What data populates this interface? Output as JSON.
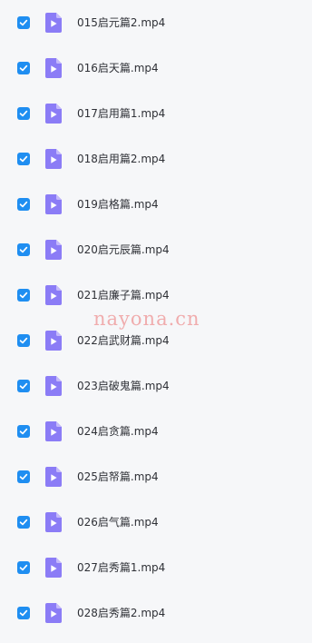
{
  "files": [
    {
      "name": "015启元篇2.mp4",
      "checked": true
    },
    {
      "name": "016启天篇.mp4",
      "checked": true
    },
    {
      "name": "017启用篇1.mp4",
      "checked": true
    },
    {
      "name": "018启用篇2.mp4",
      "checked": true
    },
    {
      "name": "019启格篇.mp4",
      "checked": true
    },
    {
      "name": "020启元辰篇.mp4",
      "checked": true
    },
    {
      "name": "021启廉子篇.mp4",
      "checked": true
    },
    {
      "name": "022启武财篇.mp4",
      "checked": true
    },
    {
      "name": "023启破鬼篇.mp4",
      "checked": true
    },
    {
      "name": "024启贪篇.mp4",
      "checked": true
    },
    {
      "name": "025启帑篇.mp4",
      "checked": true
    },
    {
      "name": "026启气篇.mp4",
      "checked": true
    },
    {
      "name": "027启秀篇1.mp4",
      "checked": true
    },
    {
      "name": "028启秀篇2.mp4",
      "checked": true
    }
  ],
  "watermark": "nayona.cn",
  "colors": {
    "checkbox": "#1f8ef1",
    "file_icon": "#8b7cf6",
    "file_icon_fold": "#c4b9fb",
    "background": "#f6f7f9",
    "text": "#2f3137"
  },
  "icons": {
    "checkbox": "checkmark-icon",
    "file": "video-file-icon"
  }
}
